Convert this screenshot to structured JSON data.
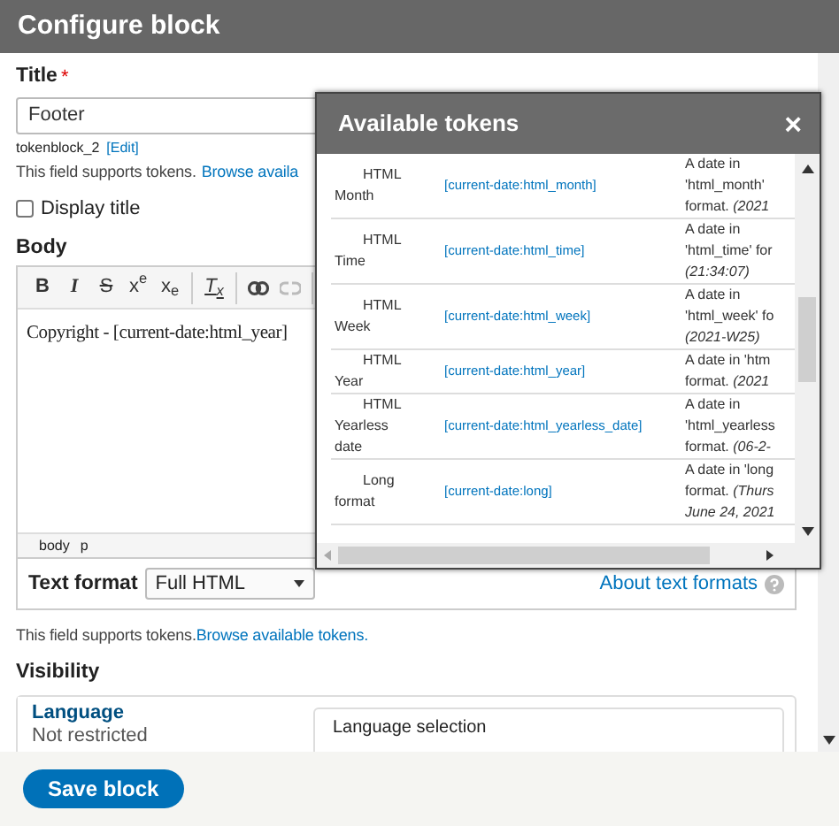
{
  "dialog": {
    "title": "Configure block"
  },
  "title_field": {
    "label": "Title",
    "required_mark": "*",
    "value": "Footer",
    "machine_name": "tokenblock_2",
    "edit_link": "[Edit]"
  },
  "token_hint_1": {
    "text": "This field supports tokens.",
    "link": "Browse availa"
  },
  "display_title": {
    "label": "Display title",
    "checked": false
  },
  "body": {
    "label": "Body",
    "toolbar": [
      [
        {
          "kind": "bold",
          "label": "B"
        },
        {
          "kind": "italic",
          "label": "I"
        },
        {
          "kind": "strike",
          "label": "S"
        },
        {
          "kind": "sup",
          "label": "x$^{e}$"
        },
        {
          "kind": "sub",
          "label": "x$_{e}$"
        }
      ],
      [
        {
          "kind": "clear",
          "label": "T$_{x}$"
        }
      ],
      [
        {
          "kind": "link"
        },
        {
          "kind": "unlink"
        }
      ]
    ],
    "content": "Copyright - [current-date:html_year]",
    "path": [
      "body",
      "p"
    ]
  },
  "text_format": {
    "label": "Text format",
    "value": "Full HTML",
    "help_link": "About text formats"
  },
  "token_hint_2": {
    "text": "This field supports tokens.",
    "link": "Browse available tokens."
  },
  "visibility": {
    "label": "Visibility",
    "tabs": [
      {
        "title": "Language",
        "summary": "Not restricted",
        "selected": true
      }
    ],
    "pane_title": "Language selection"
  },
  "footer": {
    "button": "Save block"
  },
  "tokens_dialog": {
    "title": "Available tokens",
    "close": "×",
    "rows": [
      {
        "name": "HTML\nMonth",
        "token": "[current-date:html_month]",
        "description": "A date in\n'html_month'\nformat. *(2021*"
      },
      {
        "name": "HTML\nTime",
        "token": "[current-date:html_time]",
        "description": "A date in\n'html_time' for\n*(21:34:07)*"
      },
      {
        "name": "HTML\nWeek",
        "token": "[current-date:html_week]",
        "description": "A date in\n'html_week' fo\n*(2021-W25)*"
      },
      {
        "name": "HTML\nYear",
        "token": "[current-date:html_year]",
        "description": "A date in 'htm\nformat. *(2021*"
      },
      {
        "name": "HTML\nYearless\ndate",
        "token": "[current-date:html_yearless_date]",
        "description": "A date in\n'html_yearless\nformat. *(06-2-*"
      },
      {
        "name": "Long\nformat",
        "token": "[current-date:long]",
        "description": "A date in 'long\nformat. *(Thurs*\n*June 24, 2021*"
      }
    ]
  }
}
